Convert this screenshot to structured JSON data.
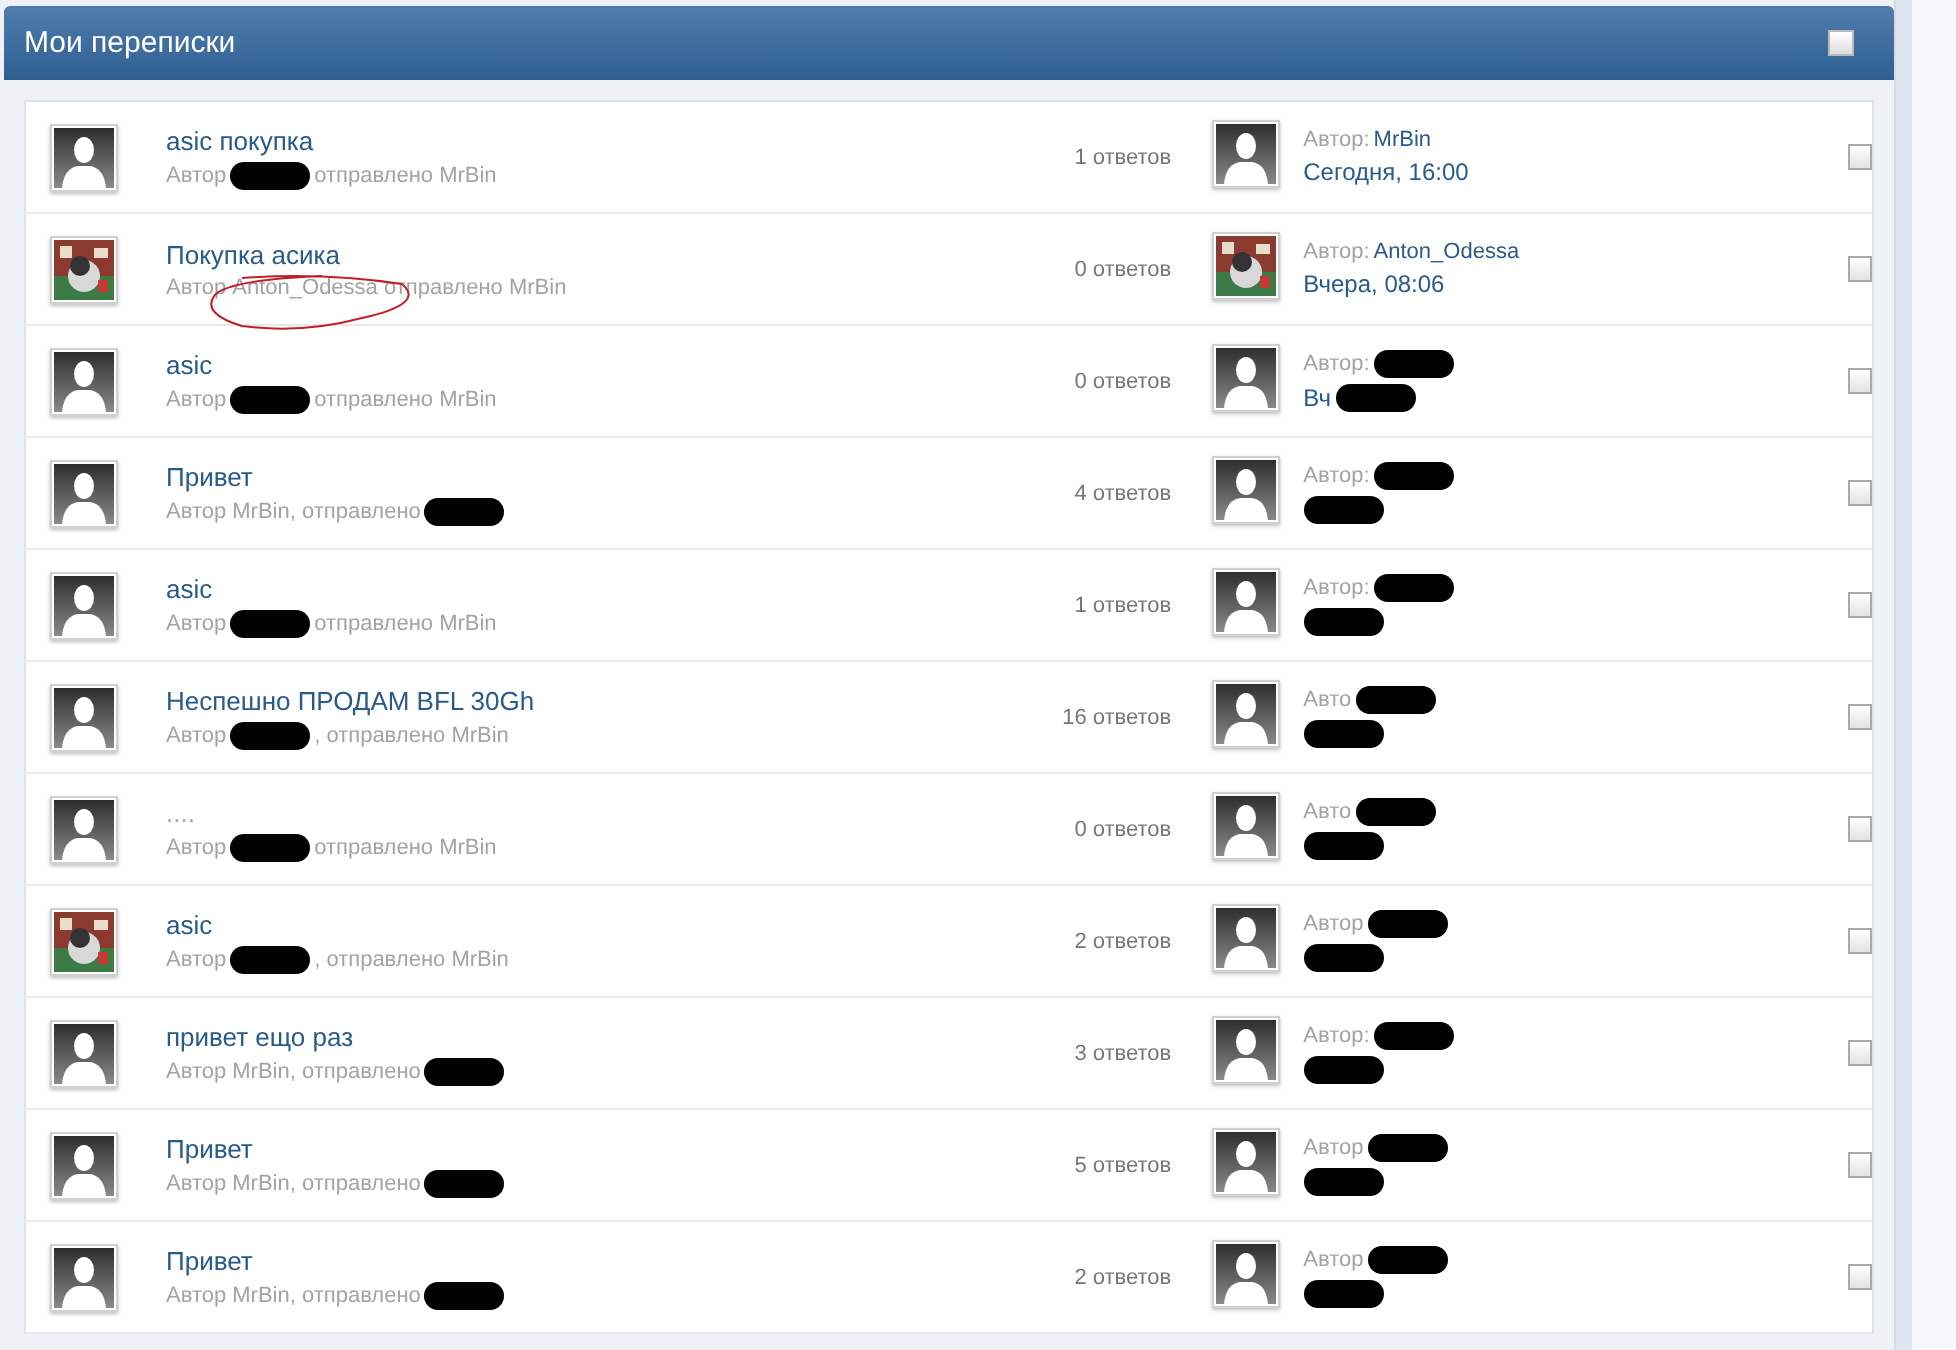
{
  "header": {
    "title": "Мои переписки",
    "select_all": {
      "checked": false
    }
  },
  "rows": [
    {
      "has_photo": false,
      "title": "asic покупка",
      "circled": false,
      "author_line": [
        {
          "kind": "text",
          "text": "Автор"
        },
        {
          "kind": "redaction"
        },
        {
          "kind": "text",
          "text": "отправлено MrBin"
        }
      ],
      "replies": "1 ответов",
      "last_has_photo": false,
      "last_line1": [
        {
          "kind": "text",
          "text": "Автор:"
        },
        {
          "kind": "link",
          "text": "MrBin"
        }
      ],
      "last_line2": [
        {
          "kind": "link",
          "text": "Сегодня, 16:00"
        }
      ],
      "checked": false
    },
    {
      "has_photo": true,
      "title": "Покупка асика",
      "circled": true,
      "author_line": [
        {
          "kind": "text",
          "text": "Автор Anton_Odessa отправлено MrBin"
        }
      ],
      "replies": "0 ответов",
      "last_has_photo": true,
      "last_line1": [
        {
          "kind": "text",
          "text": "Автор:"
        },
        {
          "kind": "link",
          "text": "Anton_Odessa"
        }
      ],
      "last_line2": [
        {
          "kind": "link",
          "text": "Вчера, 08:06"
        }
      ],
      "checked": false
    },
    {
      "has_photo": false,
      "title": "asic",
      "circled": false,
      "author_line": [
        {
          "kind": "text",
          "text": "Автор"
        },
        {
          "kind": "redaction"
        },
        {
          "kind": "text",
          "text": "отправлено MrBin"
        }
      ],
      "replies": "0 ответов",
      "last_has_photo": false,
      "last_line1": [
        {
          "kind": "text",
          "text": "Автор:"
        },
        {
          "kind": "redaction"
        }
      ],
      "last_line2": [
        {
          "kind": "link",
          "text": "Вч"
        },
        {
          "kind": "redaction"
        }
      ],
      "checked": false
    },
    {
      "has_photo": false,
      "title": "Привет",
      "circled": false,
      "author_line": [
        {
          "kind": "text",
          "text": "Автор MrBin, отправлено"
        },
        {
          "kind": "redaction"
        }
      ],
      "replies": "4 ответов",
      "last_has_photo": false,
      "last_line1": [
        {
          "kind": "text",
          "text": "Автор:"
        },
        {
          "kind": "redaction"
        }
      ],
      "last_line2": [
        {
          "kind": "redaction"
        }
      ],
      "checked": false
    },
    {
      "has_photo": false,
      "title": "asic",
      "circled": false,
      "author_line": [
        {
          "kind": "text",
          "text": "Автор"
        },
        {
          "kind": "redaction"
        },
        {
          "kind": "text",
          "text": "отправлено MrBin"
        }
      ],
      "replies": "1 ответов",
      "last_has_photo": false,
      "last_line1": [
        {
          "kind": "text",
          "text": "Автор:"
        },
        {
          "kind": "redaction"
        }
      ],
      "last_line2": [
        {
          "kind": "redaction"
        }
      ],
      "checked": false
    },
    {
      "has_photo": false,
      "title": "Неспешно ПРОДАМ BFL 30Gh",
      "circled": false,
      "author_line": [
        {
          "kind": "text",
          "text": "Автор"
        },
        {
          "kind": "redaction"
        },
        {
          "kind": "text",
          "text": ", отправлено MrBin"
        }
      ],
      "replies": "16 ответов",
      "last_has_photo": false,
      "last_line1": [
        {
          "kind": "text",
          "text": "Авто"
        },
        {
          "kind": "redaction"
        }
      ],
      "last_line2": [
        {
          "kind": "redaction"
        }
      ],
      "checked": false
    },
    {
      "has_photo": false,
      "title": "....",
      "circled": false,
      "author_line": [
        {
          "kind": "text",
          "text": "Автор"
        },
        {
          "kind": "redaction"
        },
        {
          "kind": "text",
          "text": "отправлено MrBin"
        }
      ],
      "replies": "0 ответов",
      "last_has_photo": false,
      "last_line1": [
        {
          "kind": "text",
          "text": "Авто"
        },
        {
          "kind": "redaction"
        }
      ],
      "last_line2": [
        {
          "kind": "redaction"
        }
      ],
      "checked": false
    },
    {
      "has_photo": true,
      "title": "asic",
      "circled": false,
      "author_line": [
        {
          "kind": "text",
          "text": "Автор"
        },
        {
          "kind": "redaction"
        },
        {
          "kind": "text",
          "text": ", отправлено MrBin"
        }
      ],
      "replies": "2 ответов",
      "last_has_photo": false,
      "last_line1": [
        {
          "kind": "text",
          "text": "Автор"
        },
        {
          "kind": "redaction"
        }
      ],
      "last_line2": [
        {
          "kind": "redaction"
        }
      ],
      "checked": false
    },
    {
      "has_photo": false,
      "title": "привет ещо раз",
      "circled": false,
      "author_line": [
        {
          "kind": "text",
          "text": "Автор MrBin, отправлено"
        },
        {
          "kind": "redaction"
        }
      ],
      "replies": "3 ответов",
      "last_has_photo": false,
      "last_line1": [
        {
          "kind": "text",
          "text": "Автор:"
        },
        {
          "kind": "redaction"
        }
      ],
      "last_line2": [
        {
          "kind": "redaction"
        }
      ],
      "checked": false
    },
    {
      "has_photo": false,
      "title": "Привет",
      "circled": false,
      "author_line": [
        {
          "kind": "text",
          "text": "Автор MrBin, отправлено"
        },
        {
          "kind": "redaction"
        }
      ],
      "replies": "5 ответов",
      "last_has_photo": false,
      "last_line1": [
        {
          "kind": "text",
          "text": "Автор"
        },
        {
          "kind": "redaction"
        }
      ],
      "last_line2": [
        {
          "kind": "redaction"
        }
      ],
      "checked": false
    },
    {
      "has_photo": false,
      "title": "Привет",
      "circled": false,
      "author_line": [
        {
          "kind": "text",
          "text": "Автор MrBin, отправлено"
        },
        {
          "kind": "redaction"
        }
      ],
      "replies": "2 ответов",
      "last_has_photo": false,
      "last_line1": [
        {
          "kind": "text",
          "text": "Автор"
        },
        {
          "kind": "redaction"
        }
      ],
      "last_line2": [
        {
          "kind": "redaction"
        }
      ],
      "checked": false
    }
  ]
}
